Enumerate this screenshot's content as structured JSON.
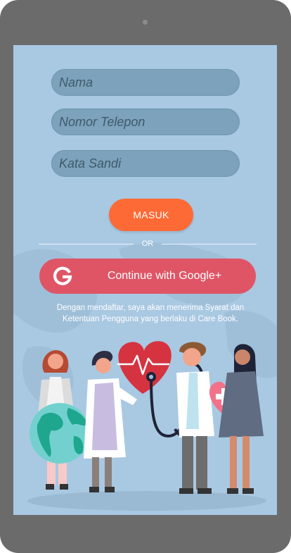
{
  "form": {
    "name_placeholder": "Nama",
    "phone_placeholder": "Nomor Telepon",
    "password_placeholder": "Kata Sandi",
    "submit_label": "MASUK"
  },
  "divider": {
    "label": "OR"
  },
  "google": {
    "icon": "google-g-icon",
    "label": "Continue with Google+"
  },
  "terms": {
    "line1": "Dengan mendaftar, saya akan menerima Syarat dan",
    "line2": "Ketentuan Pengguna yang berlaku di Care Book."
  },
  "colors": {
    "screen_bg": "#a9c8e2",
    "input_bg": "#7da2bb",
    "primary": "#fe6a35",
    "google": "#df5566",
    "device": "#6b6b6b"
  }
}
